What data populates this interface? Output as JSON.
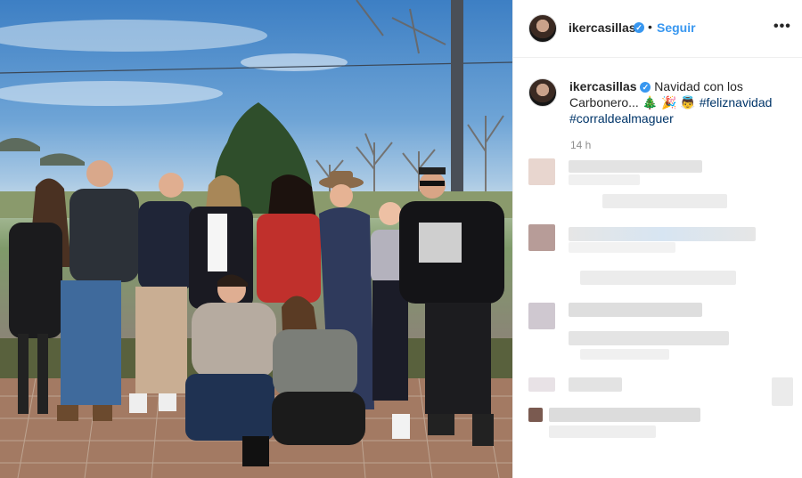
{
  "post": {
    "username": "ikercasillas",
    "follow_label": "Seguir",
    "separator": "•",
    "more_label": "•••",
    "verified_mark": "✓",
    "caption_text": "Navidad con los Carbonero... 🎄 🎉 👼",
    "hashtags": [
      "#feliznavidad",
      "#corraldealmaguer"
    ],
    "time_ago": "14 h"
  },
  "colors": {
    "link": "#3897f0",
    "hashtag": "#003569",
    "muted": "#8e8e8e"
  },
  "icons": {
    "verified": "verified-badge-icon",
    "more": "more-options-icon"
  }
}
